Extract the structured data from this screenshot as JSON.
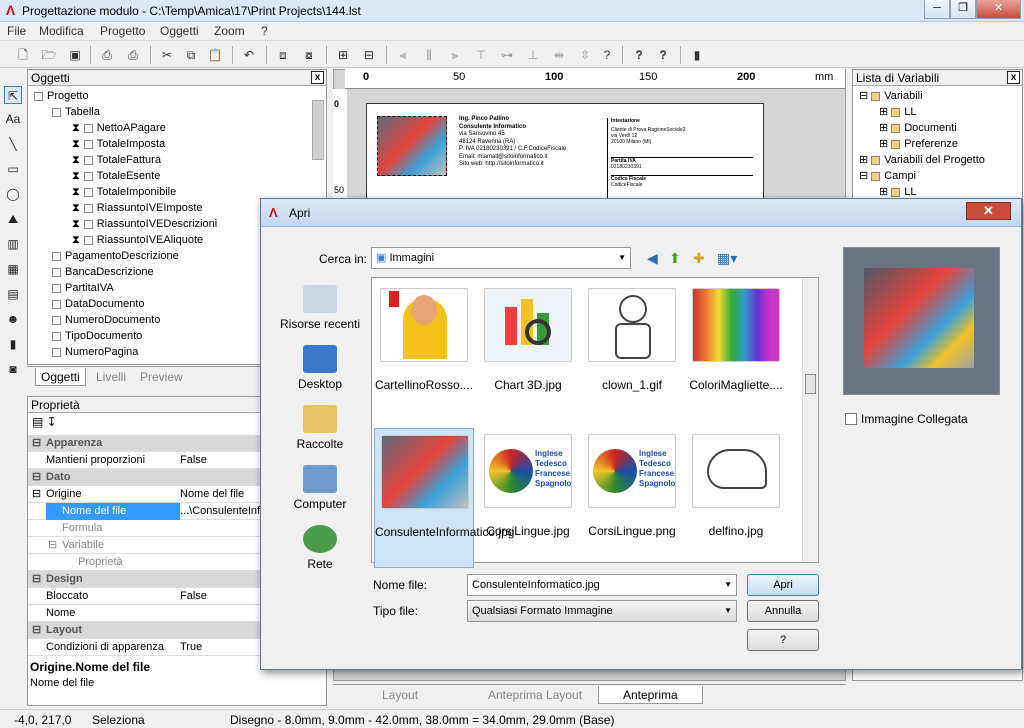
{
  "window": {
    "title": "Progettazione modulo - C:\\Temp\\Amica\\17\\Print Projects\\144.lst",
    "minimize": "─",
    "restore": "❐",
    "close": "✕"
  },
  "menu": [
    "File",
    "Modifica",
    "Progetto",
    "Oggetti",
    "Zoom",
    "?"
  ],
  "oggetti_panel": {
    "title": "Oggetti",
    "close": "x",
    "tree": [
      "Progetto",
      "Tabella",
      "NettoAPagare",
      "TotaleImposta",
      "TotaleFattura",
      "TotaleEsente",
      "TotaleImponibile",
      "RiassuntoIVEImposte",
      "RiassuntoIVEDescrizioni",
      "RiassuntoIVEAliquote",
      "PagamentoDescrizione",
      "BancaDescrizione",
      "PartitaIVA",
      "DataDocumento",
      "NumeroDocumento",
      "TipoDocumento",
      "NumeroPagina"
    ],
    "tabs": [
      "Oggetti",
      "Livelli",
      "Preview"
    ]
  },
  "proprieta": {
    "title": "Proprietà",
    "rows": [
      {
        "g": true,
        "name": "Apparenza"
      },
      {
        "name": "Mantieni proporzioni",
        "value": "False"
      },
      {
        "g": true,
        "name": "Dato"
      },
      {
        "name": "Origine",
        "value": "Nome del file"
      },
      {
        "name": "Nome del file",
        "value": "...\\ConsulenteInfo",
        "sel": true
      },
      {
        "name": "Formula",
        "value": ""
      },
      {
        "name": "Variabile",
        "value": ""
      },
      {
        "name": "Proprietà",
        "value": ""
      },
      {
        "g": true,
        "name": "Design"
      },
      {
        "name": "Bloccato",
        "value": "False"
      },
      {
        "name": "Nome",
        "value": ""
      },
      {
        "g": true,
        "name": "Layout"
      },
      {
        "name": "Condizioni di apparenza",
        "value": "True"
      }
    ],
    "desc_title": "Origine.Nome del file",
    "desc_text": "Nome del file"
  },
  "ruler": {
    "ticks": [
      "0",
      "50",
      "100",
      "150",
      "200"
    ],
    "unit": "mm",
    "vticks": [
      "0",
      "50"
    ]
  },
  "page_content": {
    "name": "Ing. Pinco Pallino",
    "role": "Consulente Informatico",
    "addr1": "via Sansovino 45",
    "addr2": "48124 Ravenna (RA)",
    "piva": "P. IVA 02180230391 / C.F.CodiceFiscale",
    "email": "Email: miamail@sitoinformatico.it",
    "web": "Sito web: http://sitoinformatico.it",
    "intest": "Intestazione",
    "cliente": "Cliente di Prova RagioneSociale2",
    "via": "via Verdi 12",
    "citta": "20100 Milano (MI)",
    "partita": "Partita IVA",
    "pnum": "02180230391",
    "cf": "Codice Fiscale",
    "cfv": "CodiceFiscale"
  },
  "bottom_tabs": [
    "Layout",
    "Anteprima Layout",
    "Anteprima"
  ],
  "variabili": {
    "title": "Lista di Variabili",
    "items": [
      "Variabili",
      "LL",
      "Documenti",
      "Preferenze",
      "Variabili del Progetto",
      "Campi",
      "LL"
    ]
  },
  "status": {
    "coords": "-4,0, 217,0",
    "mode": "Seleziona",
    "design": "Disegno  -  8.0mm, 9.0mm  -  42.0mm, 38.0mm  =  34.0mm, 29.0mm (Base)"
  },
  "dialog": {
    "title": "Apri",
    "cerca_label": "Cerca in:",
    "cerca_value": "Immagini",
    "places": [
      "Risorse recenti",
      "Desktop",
      "Raccolte",
      "Computer",
      "Rete"
    ],
    "files": [
      "CartellinoRosso....",
      "Chart 3D.jpg",
      "clown_1.gif",
      "ColoriMagliette....",
      "ConsulenteInformatico.jpg",
      "CorsiLingue.jpg",
      "CorsiLingue.png",
      "delfino.jpg"
    ],
    "lang_lines": [
      "Inglese",
      "Tedesco",
      "Francese",
      "Spagnolo"
    ],
    "nome_label": "Nome file:",
    "nome_value": "ConsulenteInformatico.jpg",
    "tipo_label": "Tipo file:",
    "tipo_value": "Qualsiasi Formato Immagine",
    "apri": "Apri",
    "annulla": "Annulla",
    "help": "?",
    "collegata": "Immagine Collegata"
  }
}
